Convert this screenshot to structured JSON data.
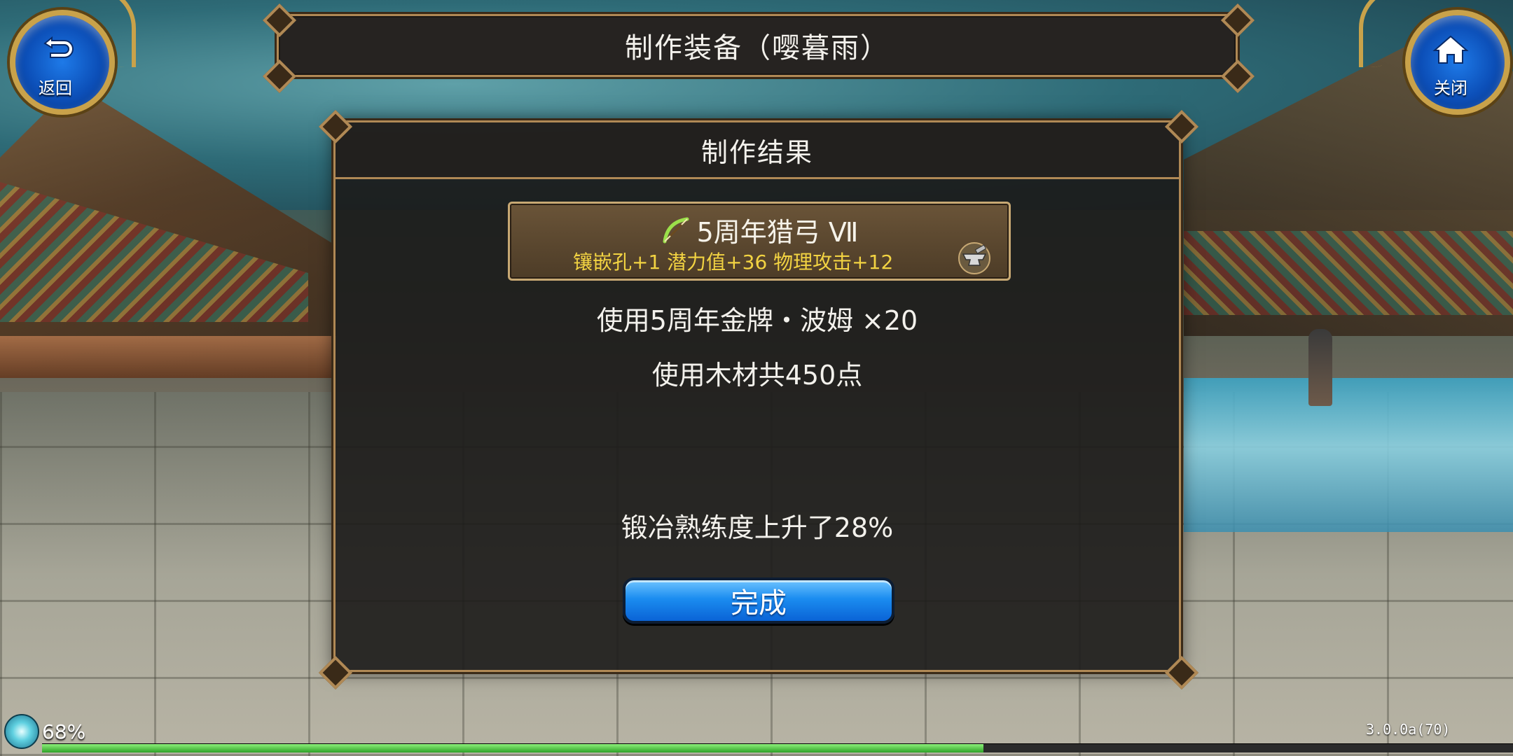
{
  "nav": {
    "back_label": "返回",
    "close_label": "关闭"
  },
  "title": "制作装备（嘤暮雨）",
  "dialog": {
    "header": "制作结果",
    "item": {
      "icon": "bow-icon",
      "name": "5周年猎弓 Ⅶ",
      "stats": "镶嵌孔+1 潜力值+36 物理攻击+12",
      "detail_icon": "anvil-icon"
    },
    "messages": {
      "material_used": "使用5周年金牌・波姆 ×20",
      "wood_used": "使用木材共450点",
      "proficiency": "锻冶熟练度上升了28%"
    },
    "done_label": "完成"
  },
  "hud": {
    "battery_percent": "68%",
    "version": "3.0.0a(70)",
    "exp_fraction": 0.64
  },
  "colors": {
    "frame_gold": "#b08955",
    "stat_yellow": "#f2d342",
    "button_blue": "#1b8df0",
    "exp_green": "#2ea227"
  }
}
